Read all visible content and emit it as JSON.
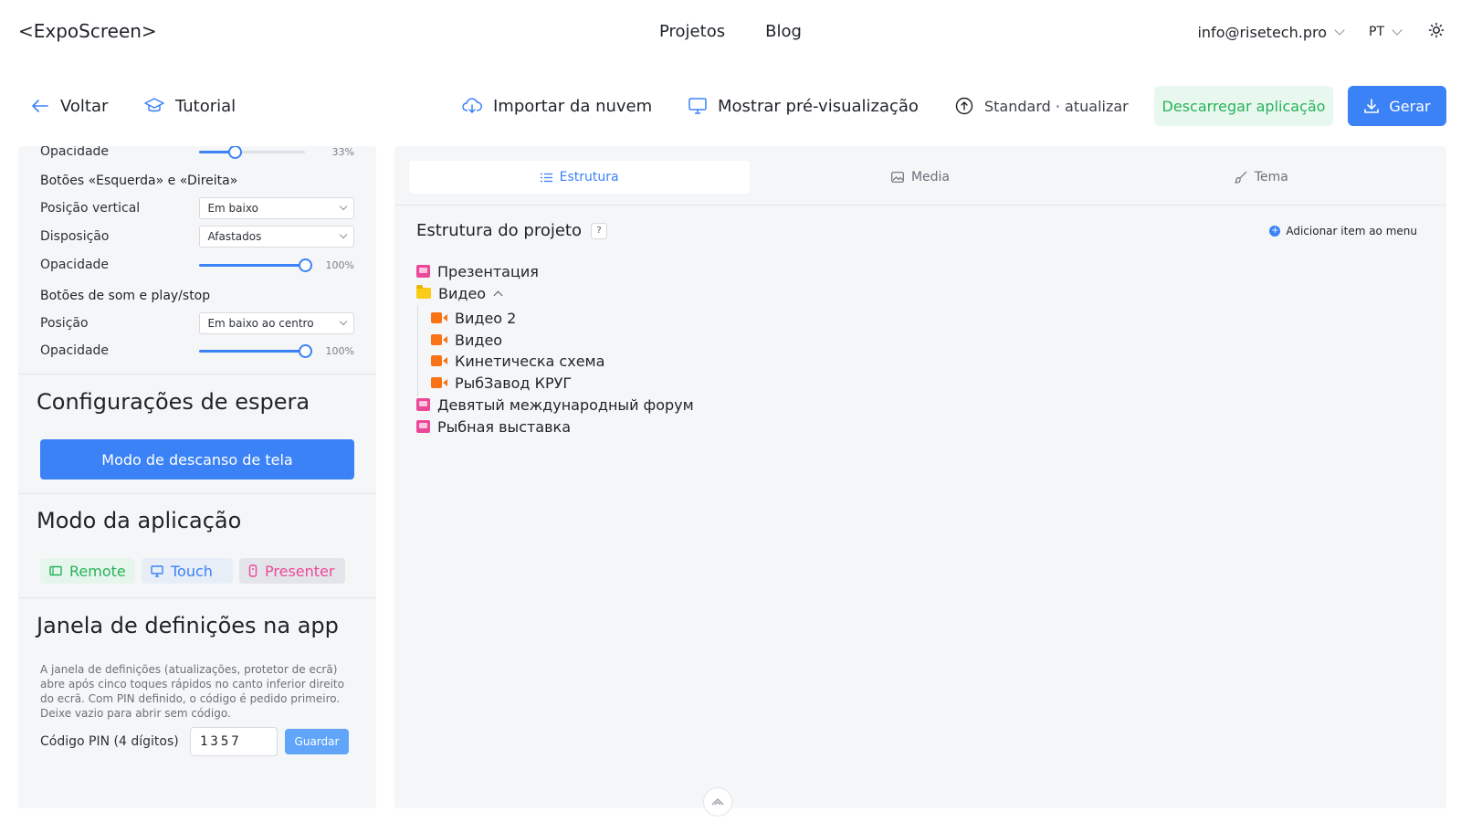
{
  "app": {
    "logo": "<ExpoScreen>"
  },
  "nav": {
    "projects": "Projetos",
    "blog": "Blog"
  },
  "account": {
    "email": "info@risetech.pro",
    "lang": "PT"
  },
  "toolbar": {
    "back": "Voltar",
    "tutorial": "Tutorial",
    "import_cloud": "Importar da nuvem",
    "show_preview": "Mostrar pré-visualização",
    "standard_update": "Standard · atualizar",
    "download_app": "Descarregar aplicação",
    "generate": "Gerar"
  },
  "left": {
    "top_opacity": {
      "label": "Opacidade",
      "value": 33,
      "text": "33%"
    },
    "lr_buttons": {
      "title": "Botões «Esquerda» e «Direita»",
      "vpos_label": "Posição vertical",
      "vpos_value": "Em baixo",
      "layout_label": "Disposição",
      "layout_value": "Afastados",
      "opacity_label": "Opacidade",
      "opacity_value": 100,
      "opacity_text": "100%"
    },
    "sound_buttons": {
      "title": "Botões de som e play/stop",
      "pos_label": "Posição",
      "pos_value": "Em baixo ao centro",
      "opacity_label": "Opacidade",
      "opacity_value": 100,
      "opacity_text": "100%"
    },
    "standby": {
      "title": "Configurações de espera",
      "button": "Modo de descanso de tela"
    },
    "app_mode": {
      "title": "Modo da aplicação",
      "remote": "Remote",
      "touch": "Touch",
      "presenter": "Presenter",
      "colors": {
        "remote": "#27b25a",
        "touch": "#3b82f6",
        "presenter": "#ec4899"
      }
    },
    "settings_window": {
      "title": "Janela de definições na app",
      "description": "A janela de definições (atualizações, protetor de ecrã) abre após cinco toques rápidos no canto inferior direito do ecrã. Com PIN definido, o código é pedido primeiro. Deixe vazio para abrir sem código.",
      "pin_label": "Código PIN (4 dígitos)",
      "pin_value": "1357",
      "save": "Guardar"
    }
  },
  "right": {
    "tabs": {
      "structure": "Estrutura",
      "media": "Media",
      "theme": "Tema"
    },
    "title": "Estrutura do projeto",
    "help": "?",
    "add_menu": "Adicionar item ao menu",
    "tree": [
      {
        "label": "Презентация",
        "type": "presentation",
        "level": 0
      },
      {
        "label": "Видео",
        "type": "folder",
        "level": 0
      },
      {
        "label": "Видео 2",
        "type": "video",
        "level": 1
      },
      {
        "label": "Видео",
        "type": "video",
        "level": 1
      },
      {
        "label": "Кинетическа схема",
        "type": "video",
        "level": 1
      },
      {
        "label": "РыбЗавод КРУГ",
        "type": "video",
        "level": 1
      },
      {
        "label": "Девятый международный форум",
        "type": "presentation",
        "level": 0
      },
      {
        "label": "Рыбная выставка",
        "type": "presentation",
        "level": 0
      }
    ]
  }
}
